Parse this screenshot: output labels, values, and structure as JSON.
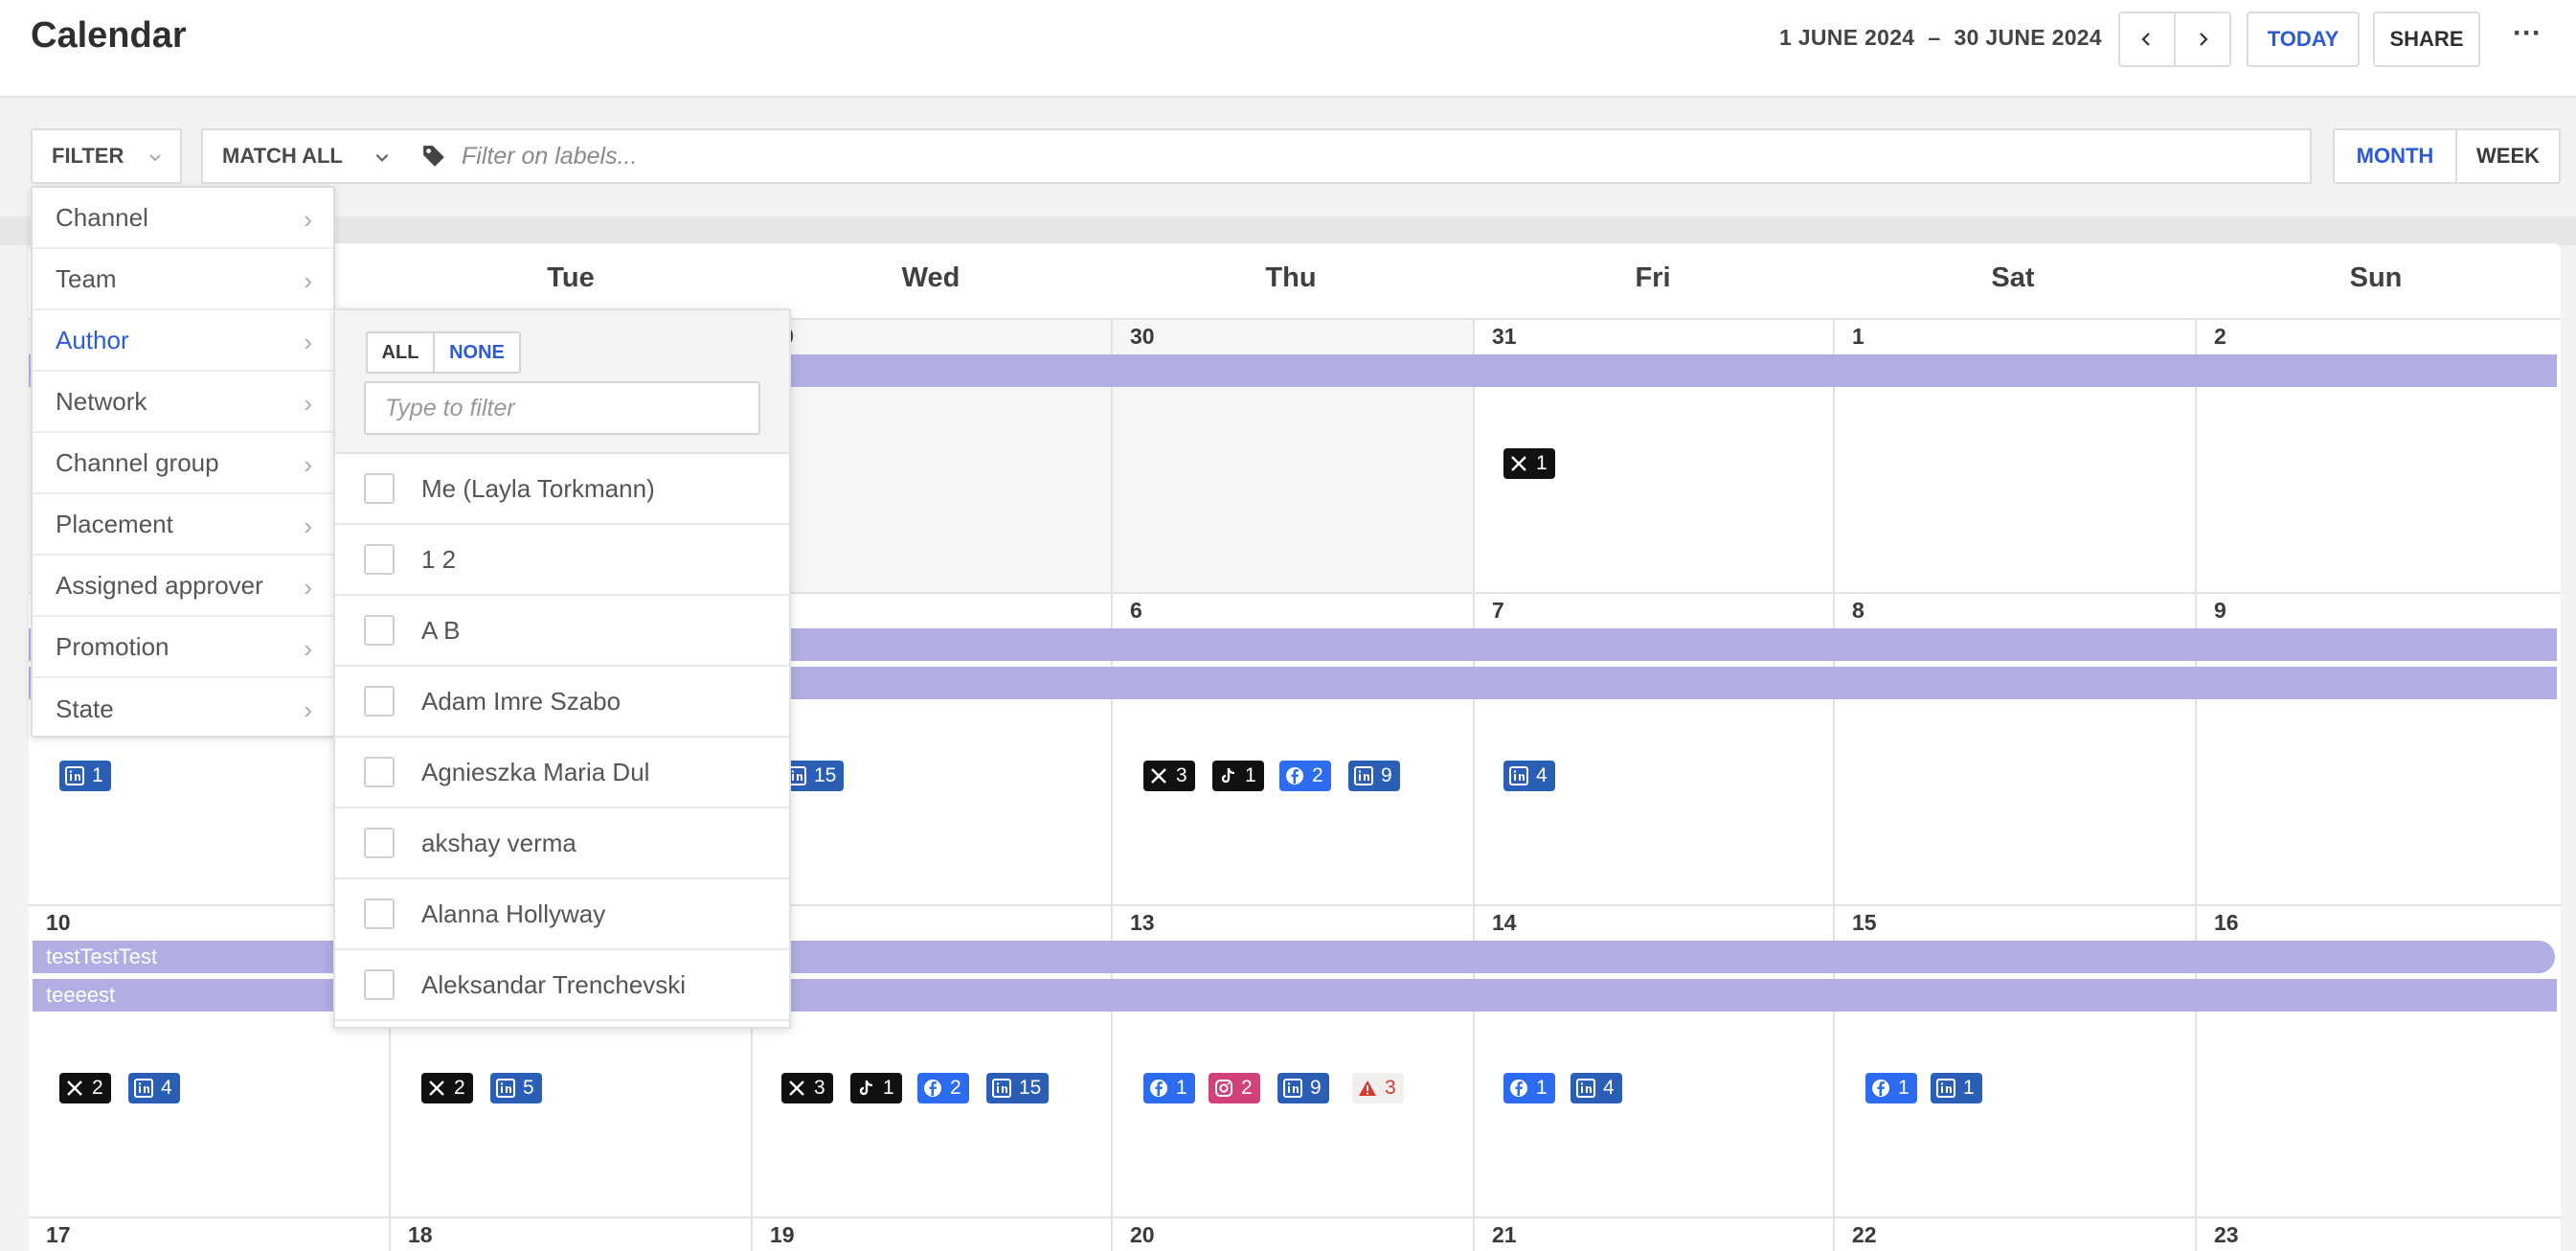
{
  "header": {
    "title": "Calendar",
    "range_start": "1 JUNE 2024",
    "range_sep": "–",
    "range_end": "30 JUNE 2024",
    "today_label": "TODAY",
    "share_label": "SHARE",
    "more_label": "···"
  },
  "filters": {
    "filter_label": "FILTER",
    "match_label": "MATCH ALL",
    "labels_placeholder": "Filter on labels...",
    "view_month": "MONTH",
    "view_week": "WEEK"
  },
  "filter_menu": {
    "items": [
      "Channel",
      "Team",
      "Author",
      "Network",
      "Channel group",
      "Placement",
      "Assigned approver",
      "Promotion",
      "State"
    ],
    "active": "Author"
  },
  "author_submenu": {
    "all_label": "ALL",
    "none_label": "NONE",
    "search_placeholder": "Type to filter",
    "authors": [
      "Me (Layla Torkmann)",
      "1 2",
      "A B",
      "Adam Imre Szabo",
      "Agnieszka Maria Dul",
      "akshay verma",
      "Alanna Hollyway",
      "Aleksandar Trenchevski"
    ]
  },
  "calendar": {
    "weekdays": [
      "Tue",
      "Wed",
      "Thu",
      "Fri",
      "Sat",
      "Sun"
    ],
    "week1_dates": [
      "9",
      "30",
      "31",
      "1",
      "2"
    ],
    "week2_dates": [
      "6",
      "7",
      "8",
      "9"
    ],
    "week3_dates": [
      "10",
      "13",
      "14",
      "15",
      "16"
    ],
    "week4_dates": [
      "17",
      "18",
      "19",
      "20",
      "21",
      "22",
      "23"
    ],
    "events": {
      "testTestTest": "testTestTest",
      "teeeest": "teeeest"
    },
    "badges": {
      "w1_fri_x": "1",
      "w2_mon_li": "1",
      "w2_wed_li": "15",
      "w2_thu_x": "3",
      "w2_thu_tt": "1",
      "w2_thu_fb": "2",
      "w2_thu_li": "9",
      "w2_fri_li": "4",
      "w3_mon_x": "2",
      "w3_mon_li": "4",
      "w3_tue_x": "2",
      "w3_tue_li": "5",
      "w3_wed_x": "3",
      "w3_wed_tt": "1",
      "w3_wed_fb": "2",
      "w3_wed_li": "15",
      "w3_thu_fb": "1",
      "w3_thu_ig": "2",
      "w3_thu_li": "9",
      "w3_thu_warn": "3",
      "w3_fri_fb": "1",
      "w3_fri_li": "4",
      "w3_sat_fb": "1",
      "w3_sat_li": "1"
    }
  },
  "colors": {
    "accent": "#2d5bd7",
    "event_bar": "#b0aee3",
    "linkedin": "#2a5fb5",
    "facebook": "#2d6bf0",
    "instagram": "#d1417a",
    "warning": "#d63a2f"
  }
}
